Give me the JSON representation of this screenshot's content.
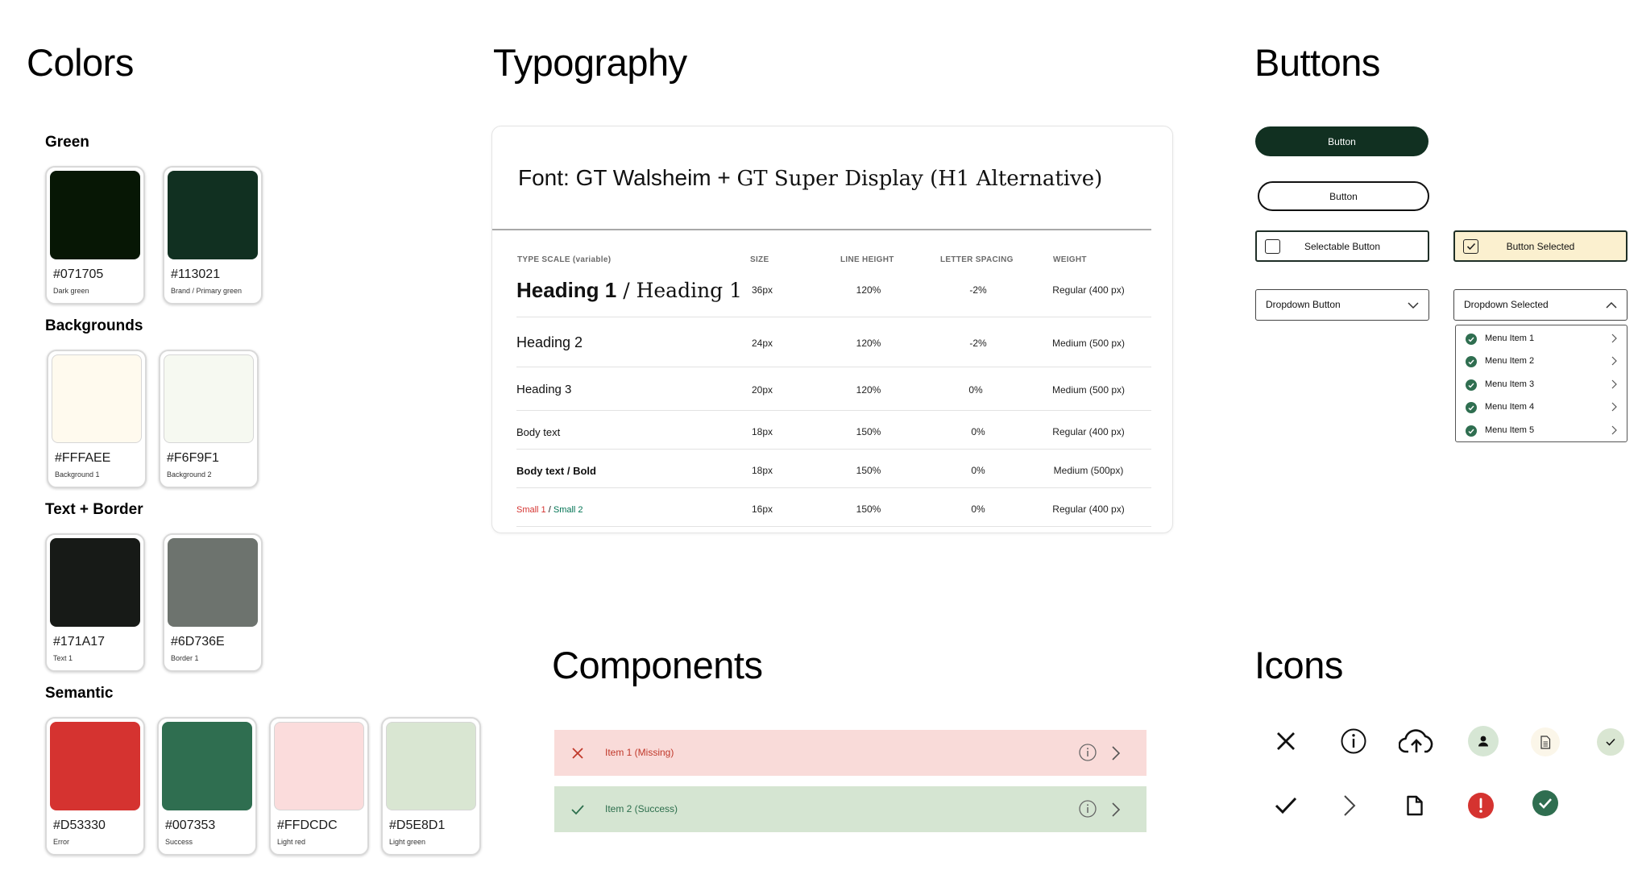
{
  "sections": {
    "colors": "Colors",
    "typography": "Typography",
    "buttons": "Buttons",
    "components": "Components",
    "icons": "Icons"
  },
  "color_groups": {
    "green": "Green",
    "backgrounds": "Backgrounds",
    "text_border": "Text + Border",
    "semantic": "Semantic"
  },
  "swatches": [
    {
      "hex": "#071705",
      "name": "Dark green",
      "color": "#071705"
    },
    {
      "hex": "#113021",
      "name": "Brand / Primary green",
      "color": "#113021"
    },
    {
      "hex": "#FFFAEE",
      "name": "Background 1",
      "color": "#FFFAEE"
    },
    {
      "hex": "#F6F9F1",
      "name": "Background 2",
      "color": "#F6F9F1"
    },
    {
      "hex": "#171A17",
      "name": "Text 1",
      "color": "#171A17"
    },
    {
      "hex": "#6D736E",
      "name": "Border 1",
      "color": "#6D736E"
    },
    {
      "hex": "#D53330",
      "name": "Error",
      "color": "#D53330"
    },
    {
      "hex": "#007353",
      "name": "Success",
      "color": "#2F6E50"
    },
    {
      "hex": "#FFDCDC",
      "name": "Light red",
      "color": "#FBDCDC"
    },
    {
      "hex": "#D5E8D1",
      "name": "Light green",
      "color": "#D9E6D2"
    }
  ],
  "typography": {
    "font_sans": "Font: GT Walsheim + ",
    "font_serif": "GT Super Display (H1 Alternative)",
    "headers": [
      "TYPE SCALE (variable)",
      "SIZE",
      "LINE HEIGHT",
      "LETTER SPACING",
      "WEIGHT"
    ],
    "h1_sans": "Heading 1",
    "h1_sep": " / ",
    "h1_serif": "Heading 1",
    "rows": [
      {
        "name": "Heading 1 / Heading 1",
        "size": "36px",
        "line_height": "120%",
        "letter_spacing": "-2%",
        "weight": "Regular (400 px)"
      },
      {
        "name": "Heading 2",
        "size": "24px",
        "line_height": "120%",
        "letter_spacing": "-2%",
        "weight": "Medium (500 px)"
      },
      {
        "name": "Heading 3",
        "size": "20px",
        "line_height": "120%",
        "letter_spacing": "0%",
        "weight": "Medium (500 px)"
      },
      {
        "name": "Body text",
        "size": "18px",
        "line_height": "150%",
        "letter_spacing": "0%",
        "weight": "Regular (400 px)"
      },
      {
        "name": "Body text / Bold",
        "size": "18px",
        "line_height": "150%",
        "letter_spacing": "0%",
        "weight": "Medium (500px)"
      },
      {
        "name": "Small 1 / Small 2",
        "size": "16px",
        "line_height": "150%",
        "letter_spacing": "0%",
        "weight": "Regular (400 px)"
      }
    ],
    "small1": "Small 1",
    "small_sep": " / ",
    "small2": "Small 2",
    "small1_color": "#D53330",
    "small2_color": "#007353"
  },
  "buttons": {
    "primary": "Button",
    "secondary": "Button",
    "selectable": "Selectable Button",
    "selected": "Button Selected",
    "dropdown": "Dropdown Button",
    "dropdown_selected": "Dropdown Selected",
    "menu_items": [
      "Menu Item 1",
      "Menu Item 2",
      "Menu Item 3",
      "Menu Item 4",
      "Menu Item 5"
    ]
  },
  "components": {
    "missing": "Item 1 (Missing)",
    "success": "Item 2 (Success)"
  },
  "icons": [
    "close-icon",
    "info-icon",
    "cloud-upload-icon",
    "user-icon",
    "document-icon",
    "check-badge-icon",
    "check-icon",
    "chevron-right-icon",
    "file-icon",
    "error-alert-icon",
    "success-check-icon"
  ]
}
